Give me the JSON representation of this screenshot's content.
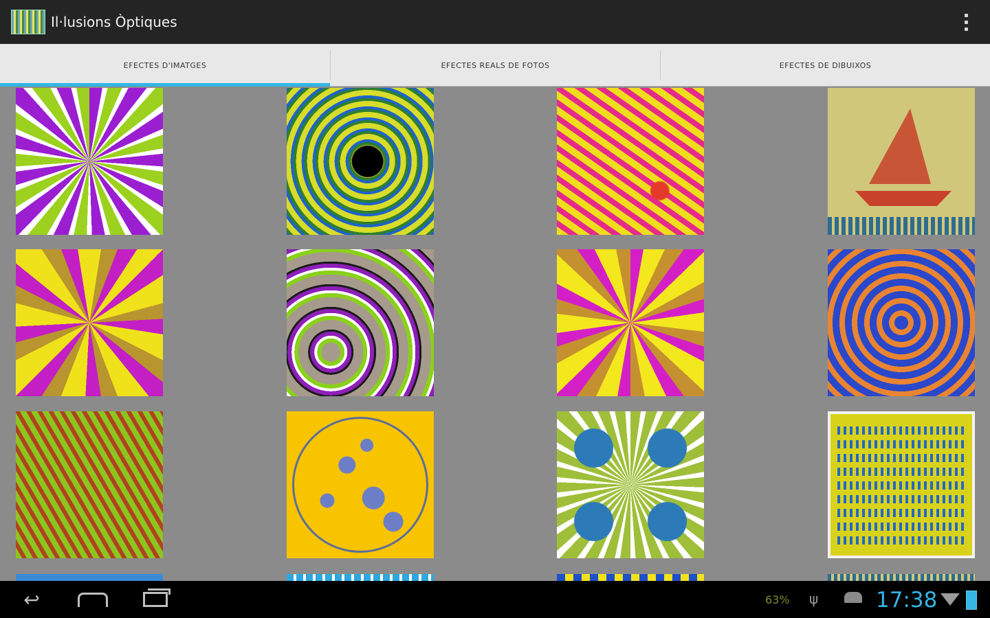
{
  "app": {
    "title": "Il·lusions Òptiques",
    "icon": "illusion-app-icon"
  },
  "action_bar": {
    "overflow_icon": "overflow-menu-icon"
  },
  "tabs": [
    {
      "label": "EFECTES D'IMATGES",
      "selected": true
    },
    {
      "label": "EFECTES REALS DE FOTOS",
      "selected": false
    },
    {
      "label": "EFECTES DE DIBUIXOS",
      "selected": false
    }
  ],
  "colors": {
    "accent": "#33b5e5",
    "action_bar": "#242424",
    "tab_bar": "#e8e8e8",
    "grid_background": "#8b8b8b",
    "nav_bar": "#000000"
  },
  "grid": {
    "columns": 4,
    "tiles": [
      "purple-green-star-illusion",
      "green-yellow-vortex-illusion",
      "pink-yellow-wave-illusion",
      "sailboat-dots-illusion",
      "yellow-purple-sphere-illusion",
      "fractal-wave-illusion",
      "yellow-purple-starburst-illusion",
      "blue-orange-tunnel-illusion",
      "green-red-wave-illusion",
      "gears-circle-illusion",
      "blue-green-rotating-snakes-illusion",
      "yellow-blue-dots-illusion",
      "partial-tile-1",
      "partial-tile-2",
      "partial-tile-3",
      "partial-tile-4"
    ]
  },
  "status_bar": {
    "battery_percent": "63%",
    "time": "17:38",
    "icons": [
      "usb-icon",
      "android-debug-icon",
      "wifi-icon",
      "battery-icon"
    ]
  },
  "nav_bar": {
    "icons": [
      "back-icon",
      "home-icon",
      "recent-apps-icon"
    ]
  }
}
